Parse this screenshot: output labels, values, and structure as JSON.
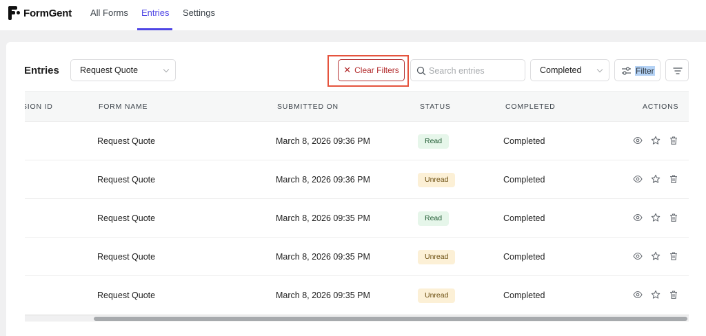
{
  "app": {
    "name": "FormGent",
    "nav": [
      {
        "label": "All Forms",
        "active": false
      },
      {
        "label": "Entries",
        "active": true
      },
      {
        "label": "Settings",
        "active": false
      }
    ],
    "accent": "#4f46e5"
  },
  "toolbar": {
    "title": "Entries",
    "form_select": "Request Quote",
    "clear_filters": "Clear Filters",
    "search_placeholder": "Search entries",
    "status_select": "Completed",
    "filter_label": "Filter"
  },
  "table": {
    "columns": [
      "SION ID",
      "FORM NAME",
      "SUBMITTED ON",
      "STATUS",
      "COMPLETED",
      "ACTIONS"
    ],
    "rows": [
      {
        "form": "Request Quote",
        "submitted": "March 8, 2026 09:36 PM",
        "status": "Read",
        "completed": "Completed"
      },
      {
        "form": "Request Quote",
        "submitted": "March 8, 2026 09:36 PM",
        "status": "Unread",
        "completed": "Completed"
      },
      {
        "form": "Request Quote",
        "submitted": "March 8, 2026 09:35 PM",
        "status": "Read",
        "completed": "Completed"
      },
      {
        "form": "Request Quote",
        "submitted": "March 8, 2026 09:35 PM",
        "status": "Unread",
        "completed": "Completed"
      },
      {
        "form": "Request Quote",
        "submitted": "March 8, 2026 09:35 PM",
        "status": "Unread",
        "completed": "Completed"
      }
    ],
    "action_icons": [
      "eye-icon",
      "star-icon",
      "trash-icon"
    ]
  },
  "colors": {
    "read_bg": "#e6f6ea",
    "unread_bg": "#fcf0d6",
    "danger": "#b32d2e",
    "highlight": "#e5533d"
  }
}
